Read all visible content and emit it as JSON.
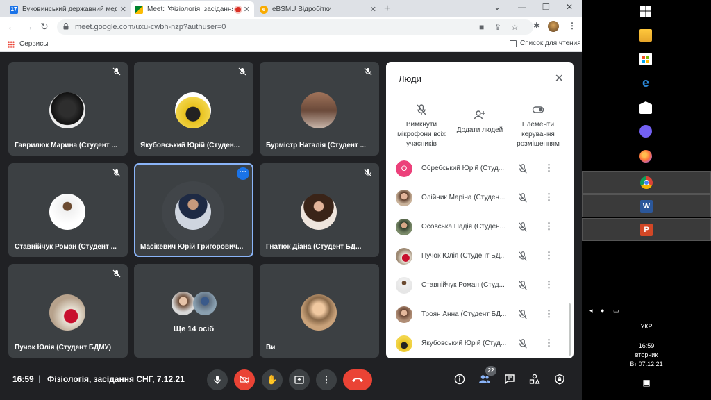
{
  "browser": {
    "tabs": [
      {
        "title": "Буковинський державний меди",
        "favicon": "calendar-favicon"
      },
      {
        "title": "Meet: \"Фізіологія, засідання",
        "favicon": "meet-favicon",
        "recording": true
      },
      {
        "title": "eBSMU Відробітки",
        "favicon": "ebsmu-favicon"
      }
    ],
    "url": "meet.google.com/uxu-cwbh-nzp?authuser=0",
    "bookmarks": {
      "apps_label": "Сервисы",
      "reading_list_label": "Список для чтения"
    }
  },
  "meet": {
    "tiles": [
      {
        "name": "Гаврилюк Марина (Студент ...",
        "muted": true
      },
      {
        "name": "Якубовський Юрій (Студен...",
        "muted": true
      },
      {
        "name": "Бурмістр Наталія (Студент ...",
        "muted": true
      },
      {
        "name": "Ставнійчук Роман (Студент ...",
        "muted": true
      },
      {
        "name": "Масікевич Юрій Григорович...",
        "muted": false,
        "speaking": true
      },
      {
        "name": "Гнатюк Діана (Студент БД...",
        "muted": true
      },
      {
        "name": "Пучок Юлія (Студент БДМУ)",
        "muted": true
      },
      {
        "name": "Ще 14 осіб",
        "muted": false
      },
      {
        "name": "Ви",
        "muted": false
      }
    ],
    "people_panel": {
      "title": "Люди",
      "actions": [
        {
          "label": "Вимкнути мікрофони всіх учасників"
        },
        {
          "label": "Додати людей"
        },
        {
          "label": "Елементи керування розміщенням"
        }
      ],
      "participants": [
        {
          "name": "Обребський Юрій (Студ...",
          "initial": "O"
        },
        {
          "name": "Олійник Маріна (Студен..."
        },
        {
          "name": "Осовська Надія (Студен..."
        },
        {
          "name": "Пучок Юлія (Студент БД..."
        },
        {
          "name": "Ставнійчук Роман (Студ..."
        },
        {
          "name": "Троян Анна (Студент БД..."
        },
        {
          "name": "Якубовський Юрій (Студ..."
        }
      ]
    },
    "bottom_bar": {
      "time": "16:59",
      "separator": "|",
      "meeting_title": "Фізіологія, засідання СНГ, 7.12.21",
      "people_count": "22"
    }
  },
  "taskbar": {
    "language": "УКР",
    "clock_time": "16:59",
    "clock_day": "вторник",
    "clock_date": "Вт 07.12.21"
  },
  "colors": {
    "accent_blue": "#1a73e8",
    "danger_red": "#ea4335",
    "meet_bg": "#202124",
    "tile_bg": "#3c4043"
  }
}
